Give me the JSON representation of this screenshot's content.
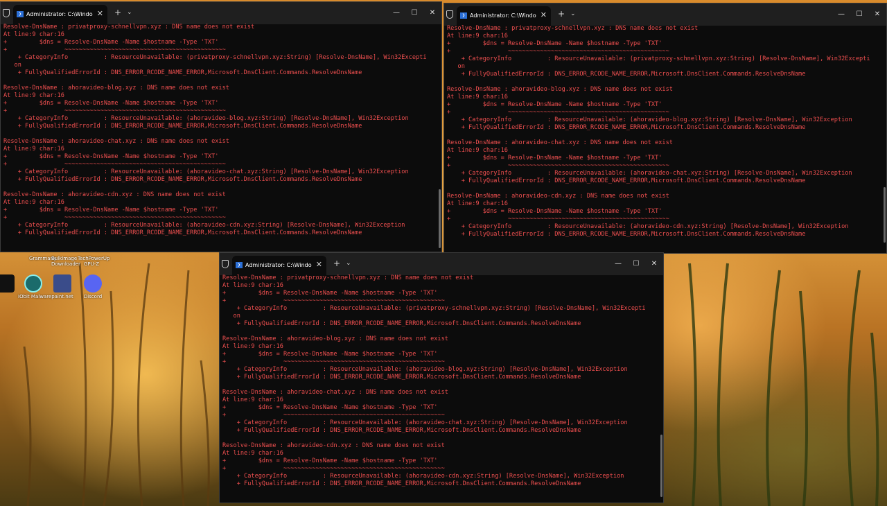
{
  "terminal": {
    "tab_title": "Administrator: C:\\Windows\\Sy",
    "tab_close": "✕",
    "new_tab": "+",
    "dropdown": "⌄",
    "minimize": "—",
    "maximize": "☐",
    "close": "✕"
  },
  "output_wide": [
    "Resolve-DnsName : privatproxy-schnellvpn.xyz : DNS name does not exist",
    "At line:9 char:16",
    "+         $dns = Resolve-DnsName -Name $hostname -Type 'TXT'",
    "+                ~~~~~~~~~~~~~~~~~~~~~~~~~~~~~~~~~~~~~~~~~~~~~",
    "    + CategoryInfo          : ResourceUnavailable: (privatproxy-schnellvpn.xyz:String) [Resolve-DnsName], Win32Excepti",
    "   on",
    "    + FullyQualifiedErrorId : DNS_ERROR_RCODE_NAME_ERROR,Microsoft.DnsClient.Commands.ResolveDnsName",
    "",
    "Resolve-DnsName : ahoravideo-blog.xyz : DNS name does not exist",
    "At line:9 char:16",
    "+         $dns = Resolve-DnsName -Name $hostname -Type 'TXT'",
    "+                ~~~~~~~~~~~~~~~~~~~~~~~~~~~~~~~~~~~~~~~~~~~~~",
    "    + CategoryInfo          : ResourceUnavailable: (ahoravideo-blog.xyz:String) [Resolve-DnsName], Win32Exception",
    "    + FullyQualifiedErrorId : DNS_ERROR_RCODE_NAME_ERROR,Microsoft.DnsClient.Commands.ResolveDnsName",
    "",
    "Resolve-DnsName : ahoravideo-chat.xyz : DNS name does not exist",
    "At line:9 char:16",
    "+         $dns = Resolve-DnsName -Name $hostname -Type 'TXT'",
    "+                ~~~~~~~~~~~~~~~~~~~~~~~~~~~~~~~~~~~~~~~~~~~~~",
    "    + CategoryInfo          : ResourceUnavailable: (ahoravideo-chat.xyz:String) [Resolve-DnsName], Win32Exception",
    "    + FullyQualifiedErrorId : DNS_ERROR_RCODE_NAME_ERROR,Microsoft.DnsClient.Commands.ResolveDnsName",
    "",
    "Resolve-DnsName : ahoravideo-cdn.xyz : DNS name does not exist",
    "At line:9 char:16",
    "+         $dns = Resolve-DnsName -Name $hostname -Type 'TXT'",
    "+                ~~~~~~~~~~~~~~~~~~~~~~~~~~~~~~~~~~~~~~~~~~~~~",
    "    + CategoryInfo          : ResourceUnavailable: (ahoravideo-cdn.xyz:String) [Resolve-DnsName], Win32Exception",
    "    + FullyQualifiedErrorId : DNS_ERROR_RCODE_NAME_ERROR,Microsoft.DnsClient.Commands.ResolveDnsName"
  ],
  "desktop": {
    "top_labels": [
      "Grammarly",
      "BulkImage Downloader",
      "TechPowerUp GPU-Z"
    ],
    "icons": [
      {
        "label": "",
        "color": "#111111"
      },
      {
        "label": "IObit Malware",
        "color": "#1b6b6b"
      },
      {
        "label": "paint.net",
        "color": "#3a4c8a"
      },
      {
        "label": "Discord",
        "color": "#5865f2"
      }
    ]
  }
}
